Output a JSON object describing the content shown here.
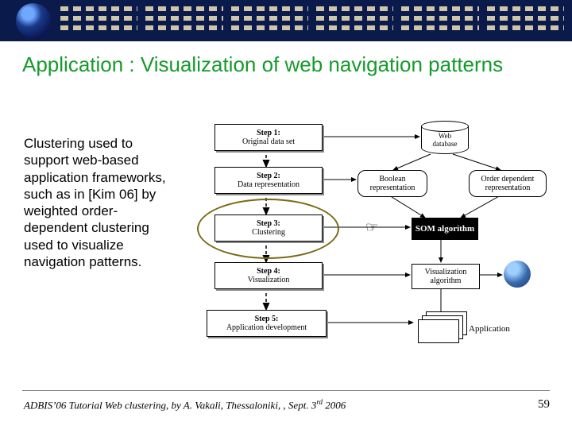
{
  "slide": {
    "title": "Application : Visualization of web navigation patterns",
    "body": "Clustering used to support web-based application frameworks, such as in [Kim 06] by weighted order-dependent clustering used to visualize navigation patterns."
  },
  "diagram": {
    "steps": {
      "s1_head": "Step 1:",
      "s1_sub": "Original data set",
      "s2_head": "Step 2:",
      "s2_sub": "Data representation",
      "s3_head": "Step 3:",
      "s3_sub": "Clustering",
      "s4_head": "Step 4:",
      "s4_sub": "Visualization",
      "s5_head": "Step 5:",
      "s5_sub": "Application development"
    },
    "right": {
      "db_top": "Web",
      "db_bot": "database",
      "bool": "Boolean representation",
      "order": "Order dependent representation",
      "som": "SOM algorithm",
      "vis": "Visualization algorithm",
      "app": "Application"
    }
  },
  "footer": {
    "text_a": "ADBIS’06 Tutorial Web clustering, by A. Vakali, Thessaloniki, , Sept. 3",
    "text_b": " 2006",
    "rd": "rd",
    "page": "59"
  }
}
